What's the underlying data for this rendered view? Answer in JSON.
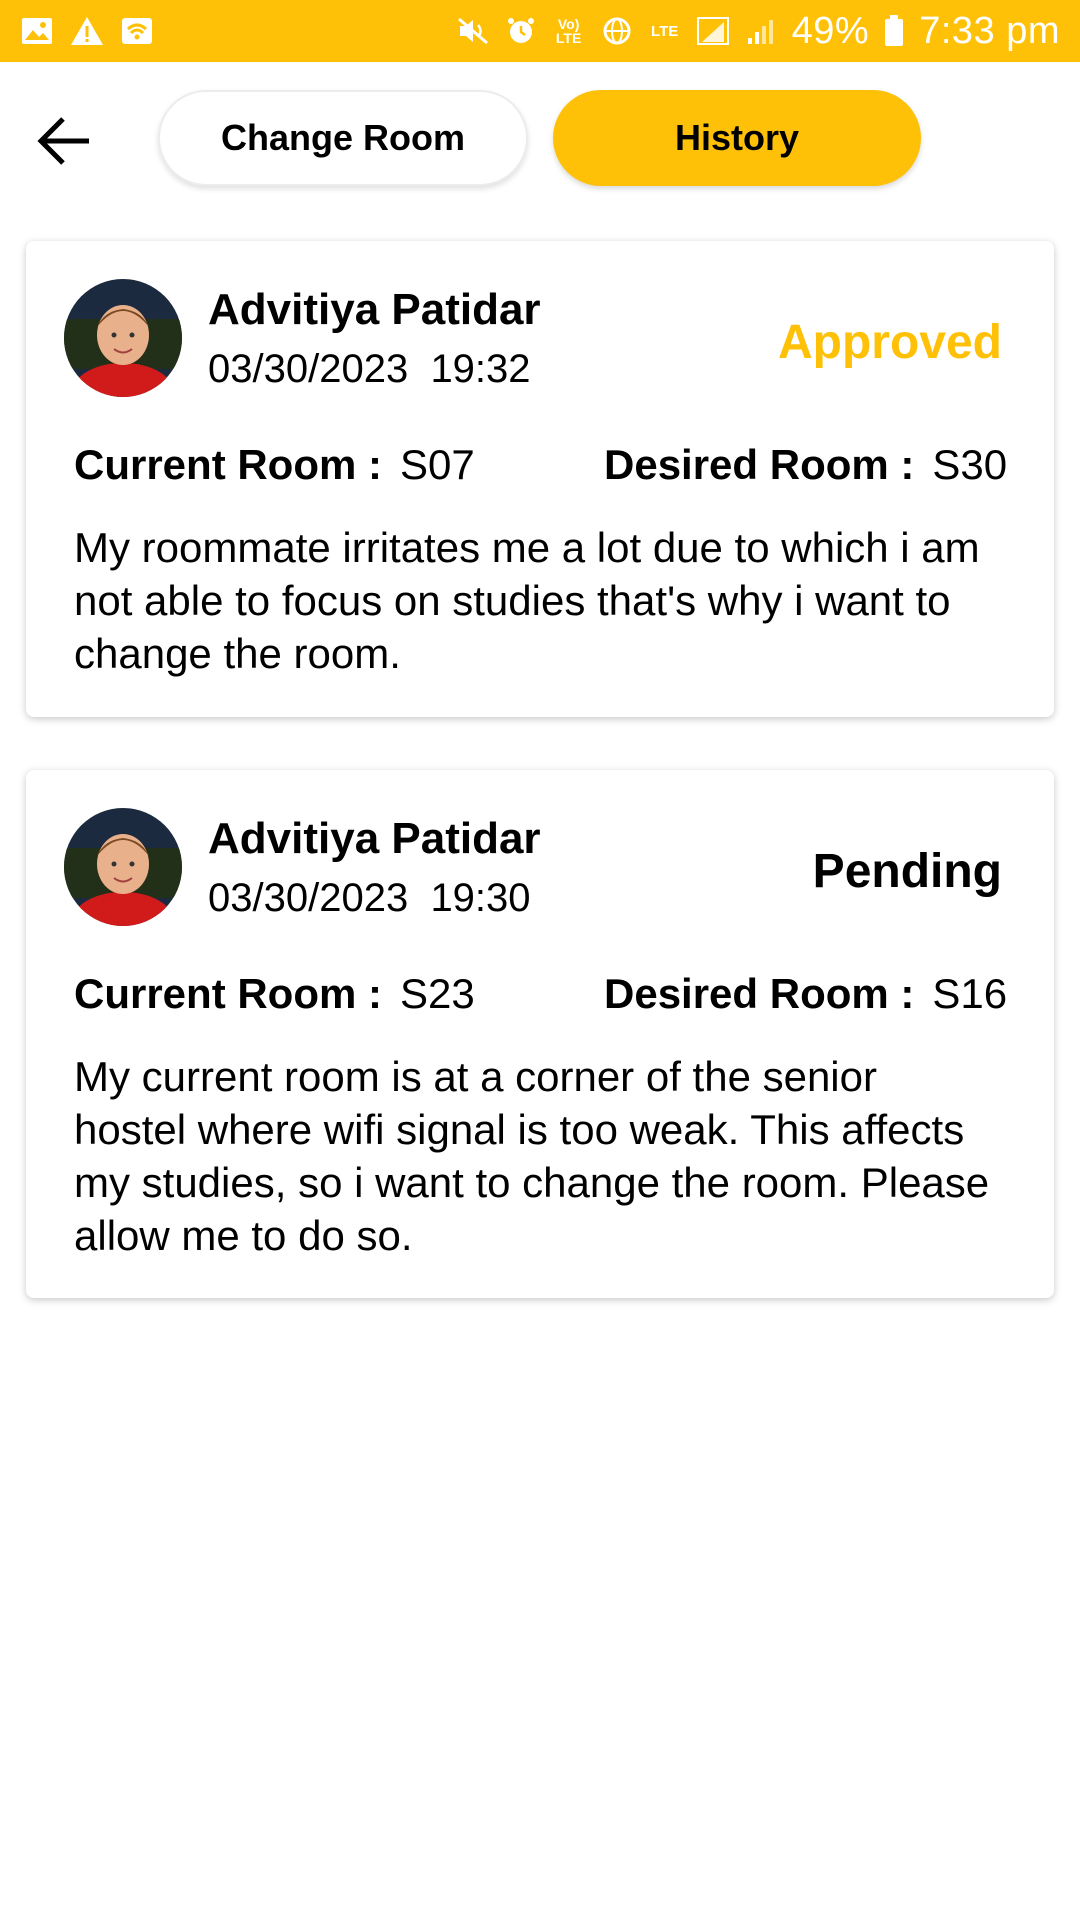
{
  "status_bar": {
    "battery": "49%",
    "time": "7:33 pm",
    "icons": [
      "image-icon",
      "warning-icon",
      "wifi-icon",
      "mute-icon",
      "alarm-icon",
      "volte-icon",
      "globe-icon",
      "lte-icon",
      "signal-icon",
      "battery-icon"
    ],
    "volte": "Vo)\nLTE",
    "lte": "LTE"
  },
  "toolbar": {
    "back_icon": "arrow-left-icon",
    "tabs": [
      {
        "label": "Change Room",
        "active": false
      },
      {
        "label": "History",
        "active": true
      }
    ]
  },
  "colors": {
    "accent": "#FFC107",
    "approved": "#FFC107",
    "pending": "#000000"
  },
  "requests": [
    {
      "name": "Advitiya Patidar",
      "date": "03/30/2023",
      "time": "19:32",
      "status": "Approved",
      "current_room_label": "Current Room :",
      "current_room": "S07",
      "desired_room_label": "Desired Room :",
      "desired_room": "S30",
      "reason": "My roommate irritates me a lot due to which i am not able to focus on studies that's why i want to change the room."
    },
    {
      "name": "Advitiya Patidar",
      "date": "03/30/2023",
      "time": "19:30",
      "status": "Pending",
      "current_room_label": "Current Room :",
      "current_room": "S23",
      "desired_room_label": "Desired Room :",
      "desired_room": "S16",
      "reason": "My current room is at a corner of the senior hostel where wifi signal is too weak. This affects my studies, so i want to change the room. Please allow me to do so."
    }
  ]
}
